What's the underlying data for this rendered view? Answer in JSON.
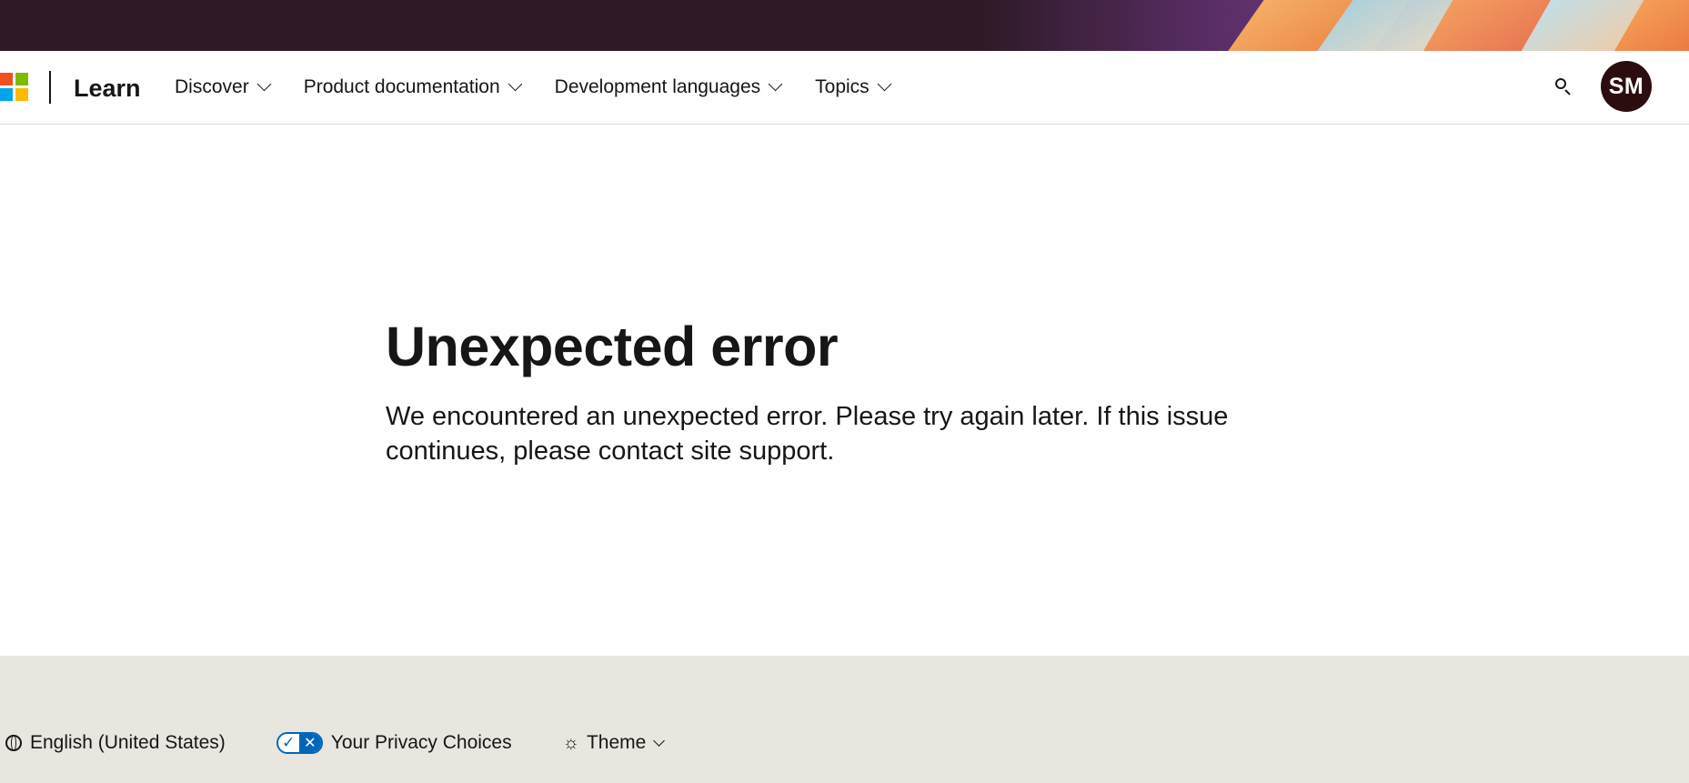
{
  "header": {
    "brand": "Learn",
    "nav": [
      {
        "label": "Discover"
      },
      {
        "label": "Product documentation"
      },
      {
        "label": "Development languages"
      },
      {
        "label": "Topics"
      }
    ],
    "avatar_initials": "SM",
    "avatar_color": "#2b0d10"
  },
  "main": {
    "title": "Unexpected error",
    "message": "We encountered an unexpected error. Please try again later. If this issue continues, please contact site support."
  },
  "footer": {
    "language": "English (United States)",
    "privacy": "Your Privacy Choices",
    "theme": "Theme"
  },
  "colors": {
    "banner": "#2e1a26",
    "footer_bg": "#e8e6df",
    "accent": "#0067b8",
    "logo": [
      "#f25022",
      "#7fba00",
      "#00a4ef",
      "#ffb900"
    ]
  }
}
